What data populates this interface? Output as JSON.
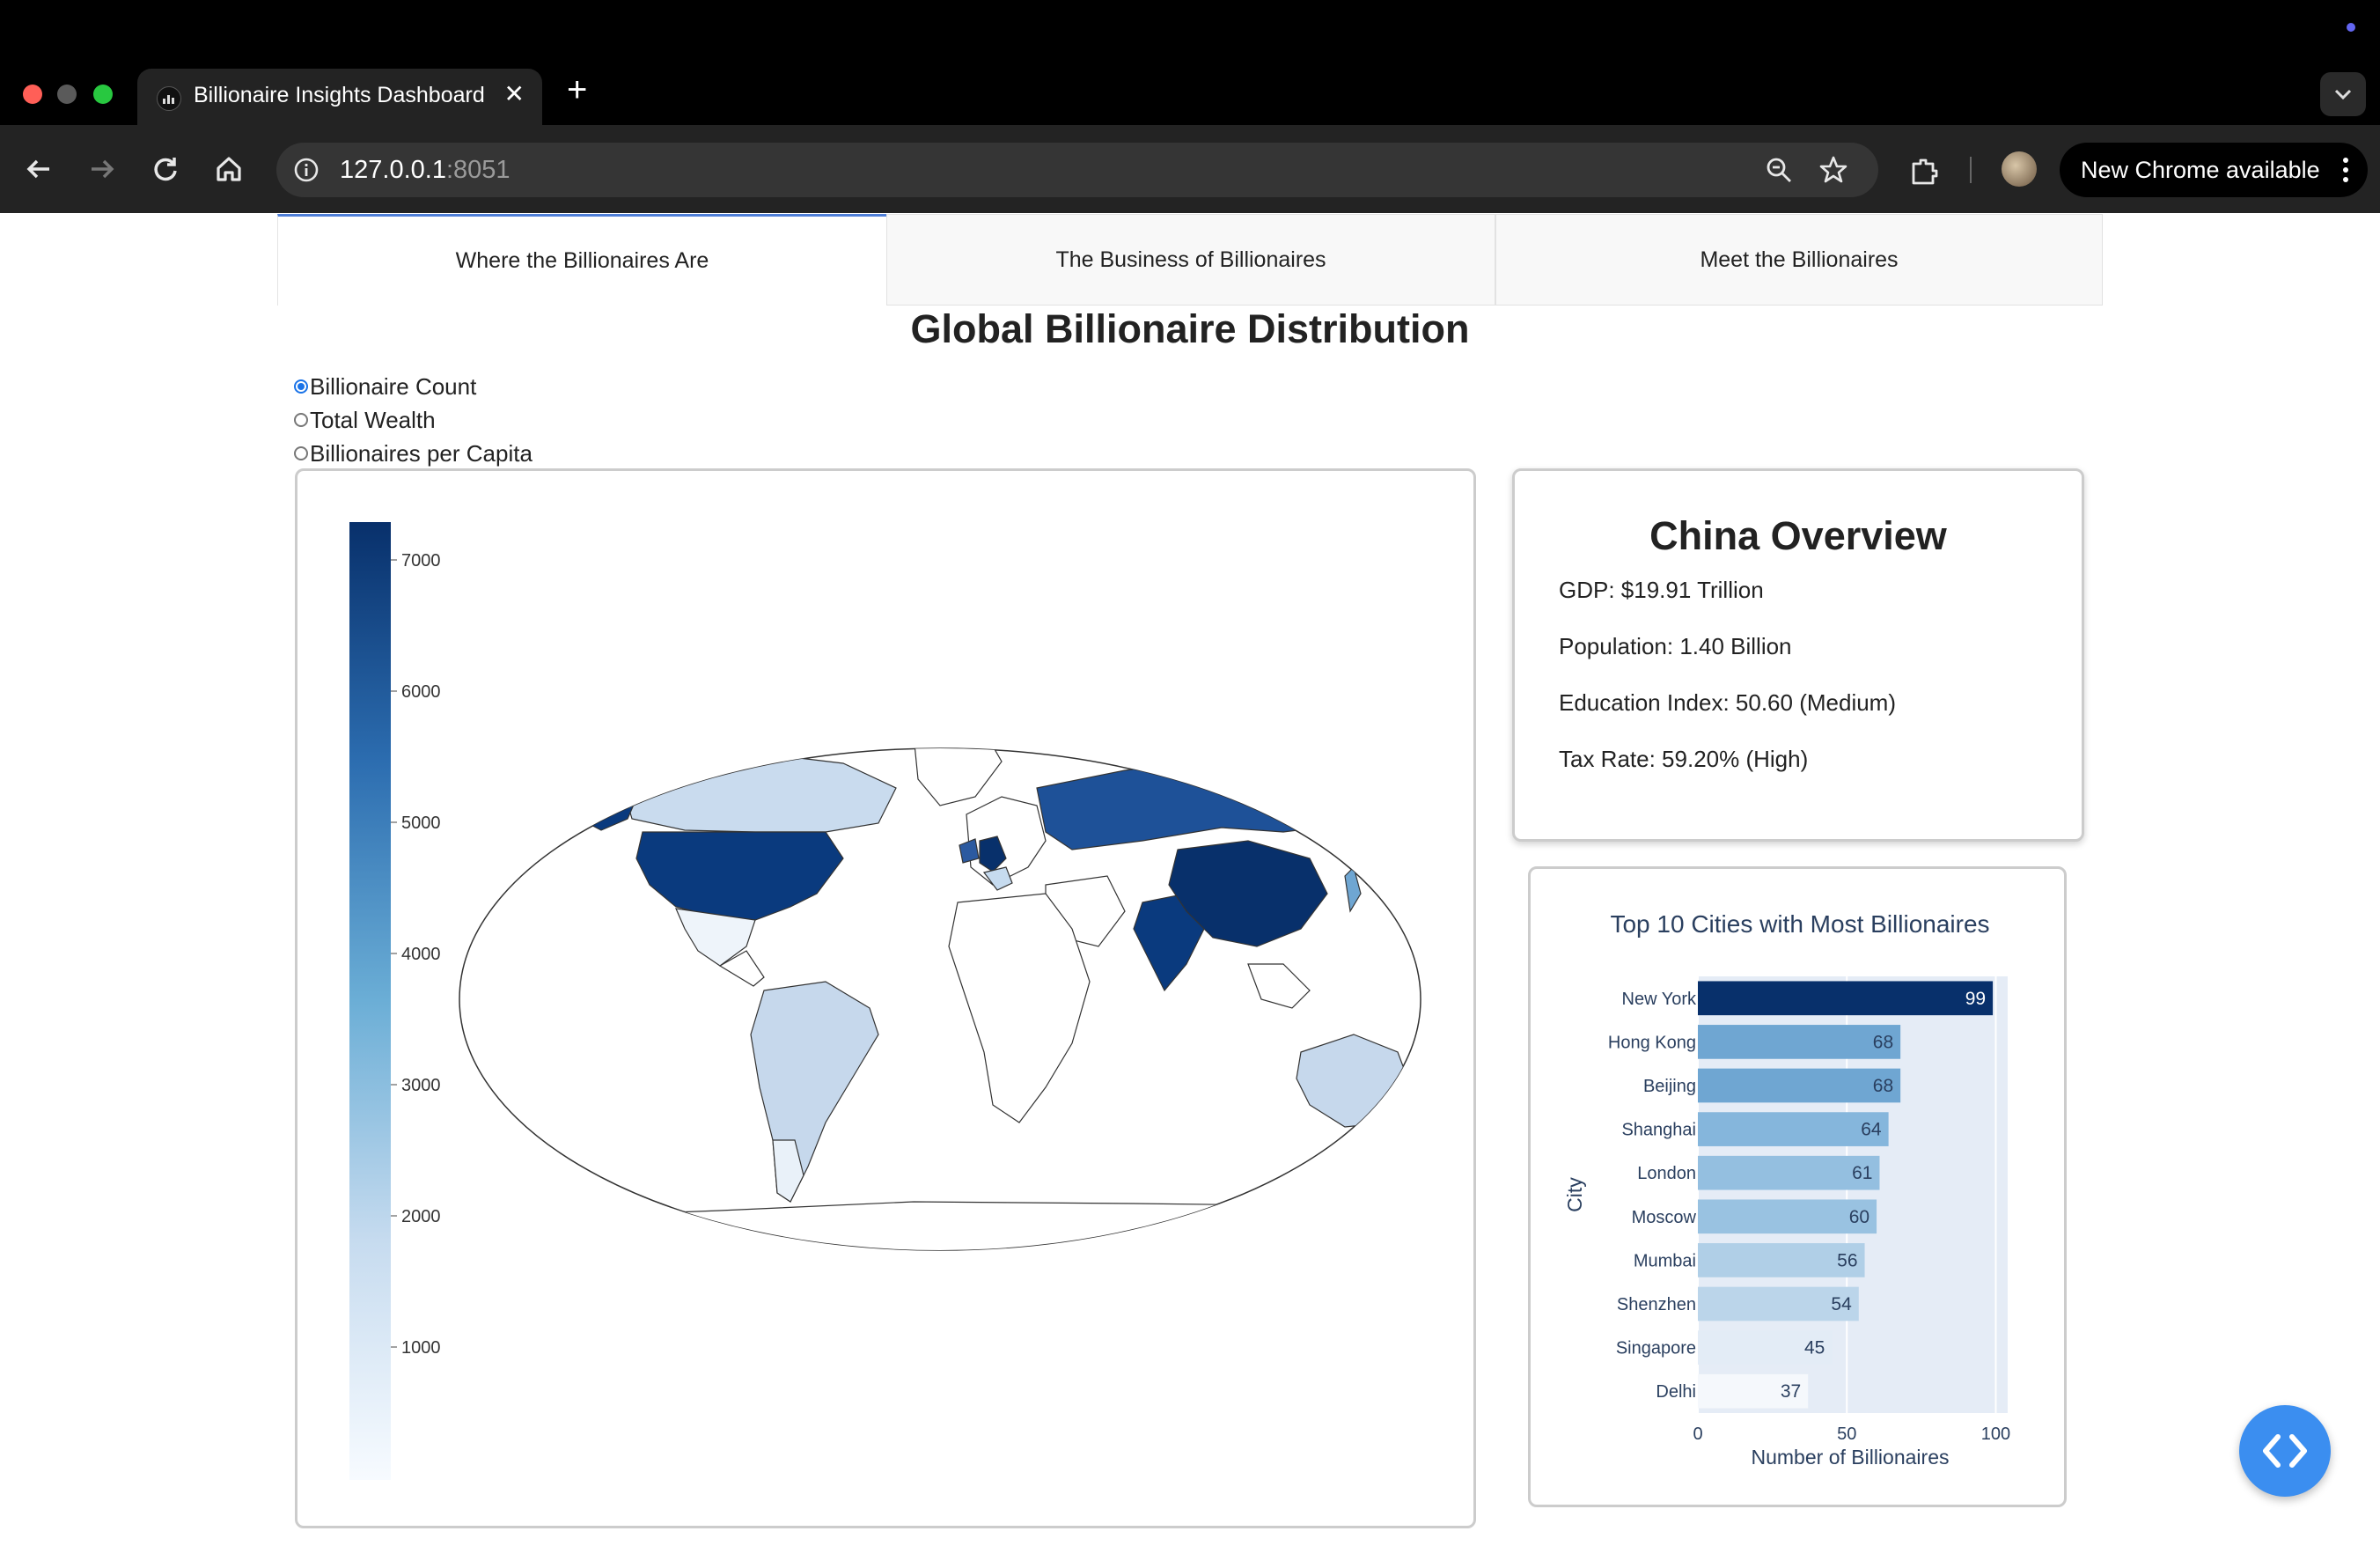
{
  "browser": {
    "tab_title": "Billionaire Insights Dashboard",
    "url_host": "127.0.0.1",
    "url_port": ":8051",
    "update_button": "New Chrome available"
  },
  "tabs": [
    {
      "label": "Where the Billionaires Are",
      "active": true
    },
    {
      "label": "The Business of Billionaires",
      "active": false
    },
    {
      "label": "Meet the Billionaires",
      "active": false
    }
  ],
  "title": "Global Billionaire Distribution",
  "metric_options": [
    {
      "label": "Billionaire Count",
      "selected": true
    },
    {
      "label": "Total Wealth",
      "selected": false
    },
    {
      "label": "Billionaires per Capita",
      "selected": false
    }
  ],
  "map": {
    "colorbar_ticks": [
      "7000",
      "6000",
      "5000",
      "4000",
      "3000",
      "2000",
      "1000"
    ],
    "colorbar_range": [
      0,
      7300
    ],
    "colorscale": "Blues"
  },
  "overview": {
    "title": "China Overview",
    "gdp": "GDP: $19.91 Trillion",
    "population": "Population: 1.40 Billion",
    "education": "Education Index: 50.60 (Medium)",
    "tax": "Tax Rate: 59.20% (High)"
  },
  "chart_data": {
    "type": "bar",
    "orientation": "horizontal",
    "title": "Top 10 Cities with Most Billionaires",
    "xlabel": "Number of Billionaires",
    "ylabel": "City",
    "categories": [
      "New York",
      "Hong Kong",
      "Beijing",
      "Shanghai",
      "London",
      "Moscow",
      "Mumbai",
      "Shenzhen",
      "Singapore",
      "Delhi"
    ],
    "values": [
      99,
      68,
      68,
      64,
      61,
      60,
      56,
      54,
      45,
      37
    ],
    "xlim": [
      0,
      104
    ],
    "xticks": [
      "0",
      "50",
      "100"
    ],
    "colors": [
      "#08306b",
      "#6fa6d2",
      "#6fa6d2",
      "#85b6dc",
      "#94bfe0",
      "#99c2e1",
      "#b0cfe7",
      "#bbd5ea",
      "#e3ecf6",
      "#f5f8fc"
    ],
    "grid": true
  }
}
